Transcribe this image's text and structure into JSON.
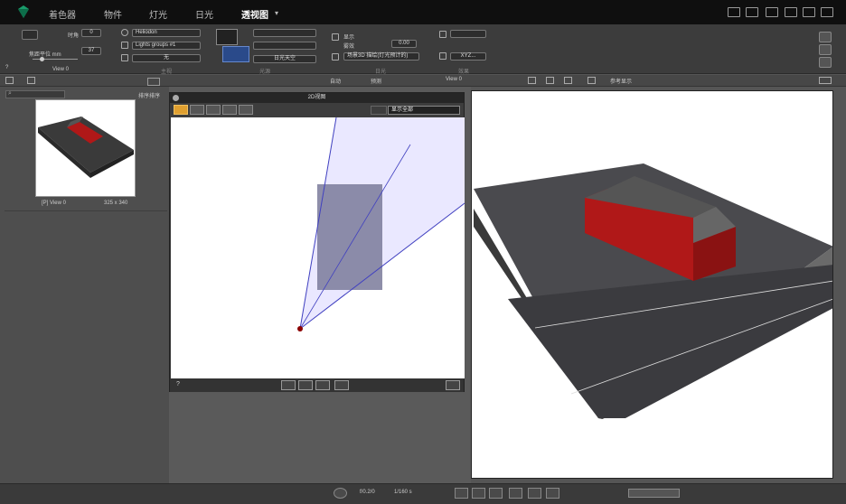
{
  "menu": {
    "items": [
      "着色器",
      "物件",
      "灯光",
      "日光",
      "透视图"
    ],
    "active_index": 4,
    "dropdown_arrow": "▾"
  },
  "ribbon": {
    "camera": {
      "field1_label": "时角",
      "field1_value": "0",
      "focal_label": "焦距平位 mm",
      "focal_value": "37",
      "view_name": "View 0",
      "help": "?"
    },
    "lighting": {
      "environment": "Heliodon",
      "lights_group": "Lights groups #1",
      "third_value": "无"
    },
    "sun": {
      "time_label": "日光天空"
    },
    "effects": {
      "opt1": "显示",
      "opt2": "雾效",
      "value": "0.00",
      "dropdown": "场景3D 描绘(灯光预计的)"
    },
    "right_fields": {
      "xyz_label": "XYZ..."
    },
    "section_labels": [
      "主视",
      "光源",
      "日光",
      "效果",
      "渲染"
    ]
  },
  "subbar": {
    "left_label": "排序排序",
    "render_label": "自动",
    "preview_label": "预测",
    "view_name": "View 0",
    "right_label": "参考显示"
  },
  "library": {
    "thumb_caption": "[P] View 0",
    "thumb_size": "325 x 340"
  },
  "window2d": {
    "title": "2D视图",
    "view_option": "显示全部",
    "help": "?"
  },
  "bottom": {
    "zoom_label": "f/0.2/0",
    "speed_label": "1/160 s"
  },
  "colors": {
    "accent": "#e0a030",
    "camera_point": "#8b0000",
    "frustum": "#4040c0",
    "building_red": "#b01818"
  }
}
